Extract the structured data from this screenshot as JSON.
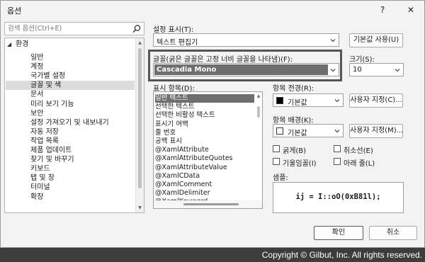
{
  "window": {
    "title": "옵션",
    "help_glyph": "?",
    "close_glyph": "✕"
  },
  "search": {
    "placeholder": "검색 옵션(Ctrl+E)"
  },
  "tree": {
    "root_label": "환경",
    "items": [
      "일반",
      "계정",
      "국가별 설정",
      "글꼴 및 색",
      "문서",
      "미리 보기 기능",
      "보안",
      "설정 가져오기 및 내보내기",
      "자동 저장",
      "작업 목록",
      "제품 업데이트",
      "찾기 및 바꾸기",
      "키보드",
      "탭 및 창",
      "터미널",
      "확장"
    ],
    "selected_index": 3
  },
  "settings_display": {
    "label": "설정 표시(T):",
    "value": "텍스트 편집기",
    "default_button": "기본값 사용(U)"
  },
  "font": {
    "label": "글꼴(굵은 글꼴은 고정 너비 글꼴을 나타냄)(F):",
    "value": "Cascadia Mono"
  },
  "size": {
    "label": "크기(S):",
    "value": "10"
  },
  "display_items": {
    "label": "표시 항목(D):",
    "items": [
      "일반 텍스트",
      "선택한 텍스트",
      "선택한 비활성 텍스트",
      "표시기 여백",
      "줄 번호",
      "공백 표시",
      "@XamlAttribute",
      "@XamlAttributeQuotes",
      "@XamlAttributeValue",
      "@XamlCData",
      "@XamlComment",
      "@XamlDelimiter",
      "@XamlKeyword"
    ],
    "selected_index": 0
  },
  "foreground": {
    "label": "항목 전경(R):",
    "value": "기본값",
    "swatch_color": "#000000",
    "custom_button": "사용자 지정(C)..."
  },
  "background": {
    "label": "항목 배경(K):",
    "value": "기본값",
    "swatch_color": "#ffffff",
    "custom_button": "사용자 지정(M)..."
  },
  "checkboxes": {
    "bold": "굵게(B)",
    "strikethrough": "취소선(E)",
    "italic": "기울임꼴(I)",
    "underline": "아래 줄(L)"
  },
  "sample": {
    "label": "샘플:",
    "text": "ij = I::oO(0xB81l);"
  },
  "buttons": {
    "ok": "확인",
    "cancel": "취소"
  },
  "footer": {
    "copyright": "Copyright © Gilbut, Inc. All rights reserved."
  }
}
